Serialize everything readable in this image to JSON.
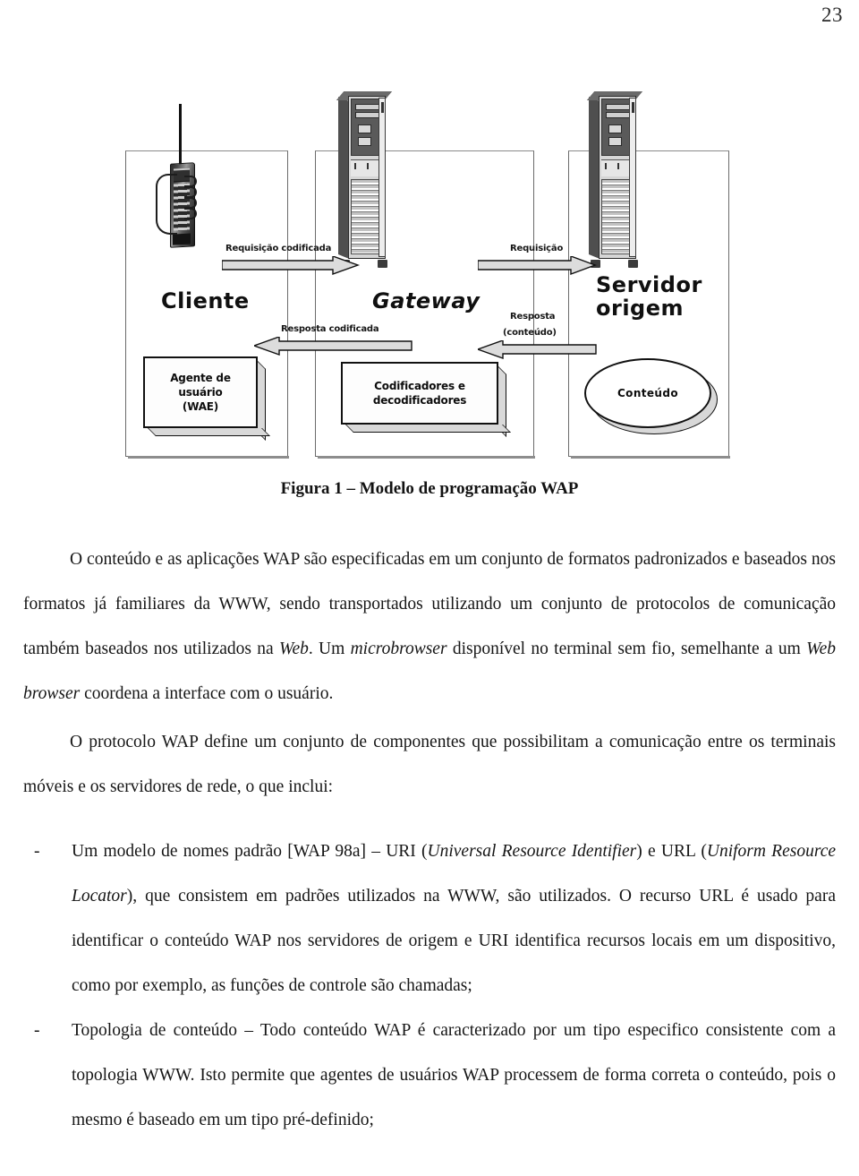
{
  "page": {
    "number": "23"
  },
  "figure": {
    "caption": "Figura 1 – Modelo de programação WAP",
    "roles": {
      "client": "Cliente",
      "gateway": "Gateway",
      "server_line1": "Servidor",
      "server_line2": "origem"
    },
    "arrows": [
      {
        "label": "Requisição codificada",
        "direction": "right"
      },
      {
        "label": "Resposta codificada",
        "direction": "left"
      },
      {
        "label": "Requisição",
        "direction": "right"
      },
      {
        "label": "Resposta",
        "label2": "(conteúdo)",
        "direction": "left"
      }
    ],
    "boxes": {
      "client_box_line1": "Agente de",
      "client_box_line2": "usuário",
      "client_box_line3": "(WAE)",
      "gateway_box_line1": "Codificadores e",
      "gateway_box_line2": "decodificadores",
      "server_store": "Conteúdo"
    }
  },
  "body": {
    "paragraph1_a": "O conteúdo e as aplicações WAP são especificadas em um conjunto de formatos padronizados e baseados nos formatos já familiares da WWW, sendo transportados utilizando um conjunto de protocolos de comunicação também baseados nos utilizados na ",
    "paragraph1_web": "Web",
    "paragraph1_b": ". Um ",
    "paragraph1_micro": "microbrowser",
    "paragraph1_c": " disponível no terminal sem fio, semelhante a um ",
    "paragraph1_webbrowser": "Web browser",
    "paragraph1_d": " coordena a interface com o usuário.",
    "paragraph2": "O protocolo WAP define um conjunto de componentes que possibilitam a comunicação entre os terminais móveis e os servidores de rede, o que inclui:",
    "bullet_marker": "-",
    "bullet1_a": "Um modelo de nomes padrão [WAP 98a] – URI (",
    "bullet1_it1": "Universal Resource Identifier",
    "bullet1_b": ") e URL (",
    "bullet1_it2": "Uniform Resource Locator",
    "bullet1_c": "), que consistem em padrões utilizados na WWW, são utilizados. O recurso URL é usado para identificar o conteúdo WAP nos servidores de origem e URI identifica recursos locais em um dispositivo, como por exemplo, as funções de controle são chamadas;",
    "bullet2": "Topologia de conteúdo – Todo conteúdo WAP é caracterizado por um tipo especifico consistente com a topologia WWW. Isto permite que agentes de usuários WAP processem de forma correta o conteúdo, pois o mesmo é baseado em um tipo pré-definido;"
  }
}
